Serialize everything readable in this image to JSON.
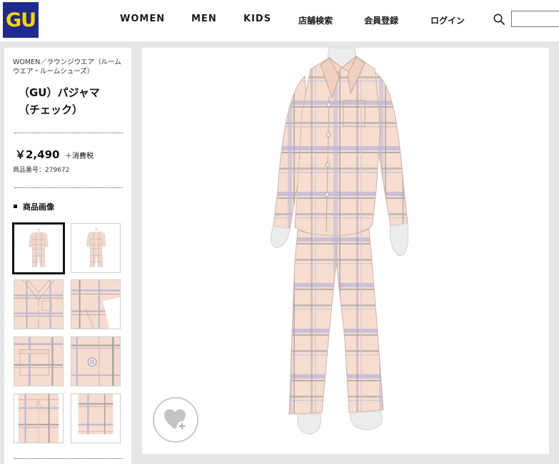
{
  "header": {
    "logo_text": "GU",
    "nav": [
      {
        "label": "WOMEN"
      },
      {
        "label": "MEN"
      },
      {
        "label": "KIDS"
      },
      {
        "label": "店舗検索"
      },
      {
        "label": "会員登録"
      },
      {
        "label": "ログイン"
      }
    ],
    "search_placeholder": ""
  },
  "product": {
    "breadcrumb": "WOMEN／ラウンジウエア（ルームウエア・ルームシューズ）",
    "title_line1": "（GU）パジャマ",
    "title_line2": "（チェック）",
    "price": "￥2,490",
    "tax_note": "＋消費税",
    "product_code": "商品番号：279672"
  },
  "gallery": {
    "section_title": "商品画像",
    "selected_index": 0
  },
  "colors": {
    "logo_bg": "#1e2a8f",
    "logo_text": "#f5d800",
    "pajama_base": "#f6ddd0",
    "plaid_lavender": "#b9b4d6",
    "plaid_gray": "#a8a39e"
  }
}
